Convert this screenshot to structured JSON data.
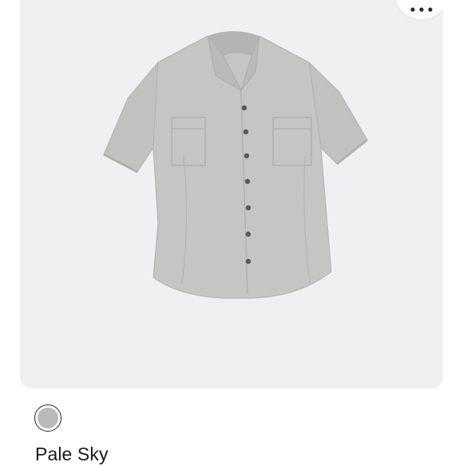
{
  "product": {
    "image_icon": "shirt-image",
    "colors": {
      "card_background": "#eef0f2",
      "swatch_fill": "#b9bbb9",
      "shirt_body": "#c3c6c2",
      "shirt_shade": "#b2b5b1",
      "button_dark": "#555a5b"
    }
  },
  "menu": {
    "icon": "more-horizontal-icon",
    "dot_color": "#1f2a44"
  },
  "selected_color": {
    "name": "Pale Sky"
  }
}
